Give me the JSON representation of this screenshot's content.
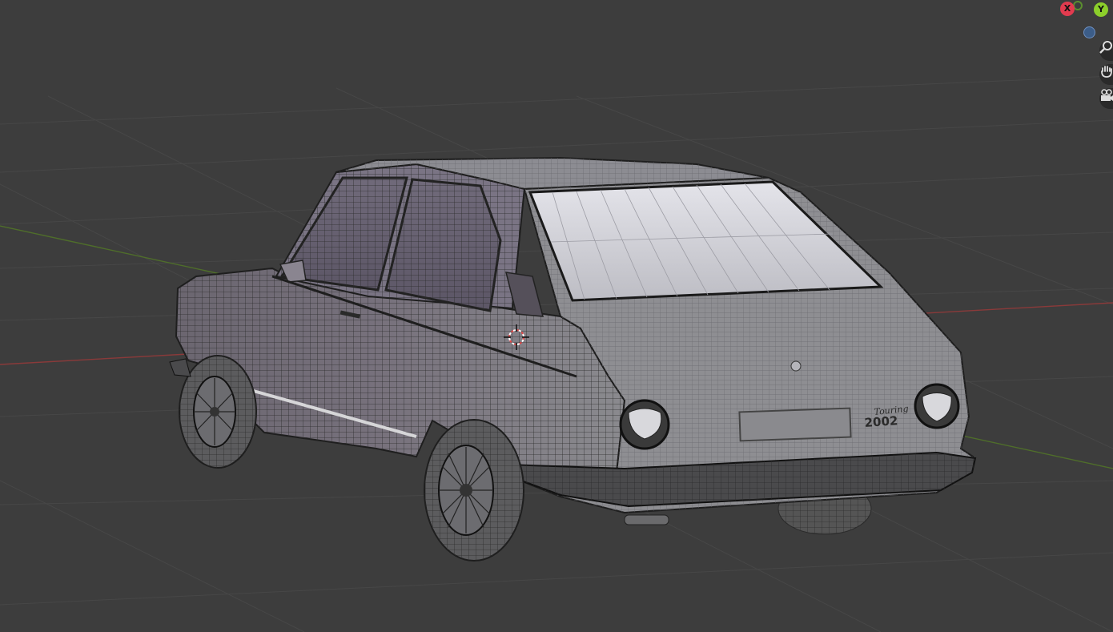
{
  "scene": {
    "background": "#3d3d3d",
    "grid_color": "#464646",
    "x_axis_color": "#8a3a3a",
    "y_axis_color": "#5a7a2a",
    "object": "car-wireframe",
    "badge_script": "Touring",
    "badge_model": "2002"
  },
  "gizmo": {
    "x_label": "X",
    "y_label": "Y",
    "x_color": "#e23b4f",
    "y_color": "#8ccf2b",
    "neg_z_color": "#3c5d88"
  },
  "nav_controls": {
    "zoom_icon": "magnifier-icon",
    "pan_icon": "hand-icon",
    "camera_icon": "camera-icon"
  }
}
